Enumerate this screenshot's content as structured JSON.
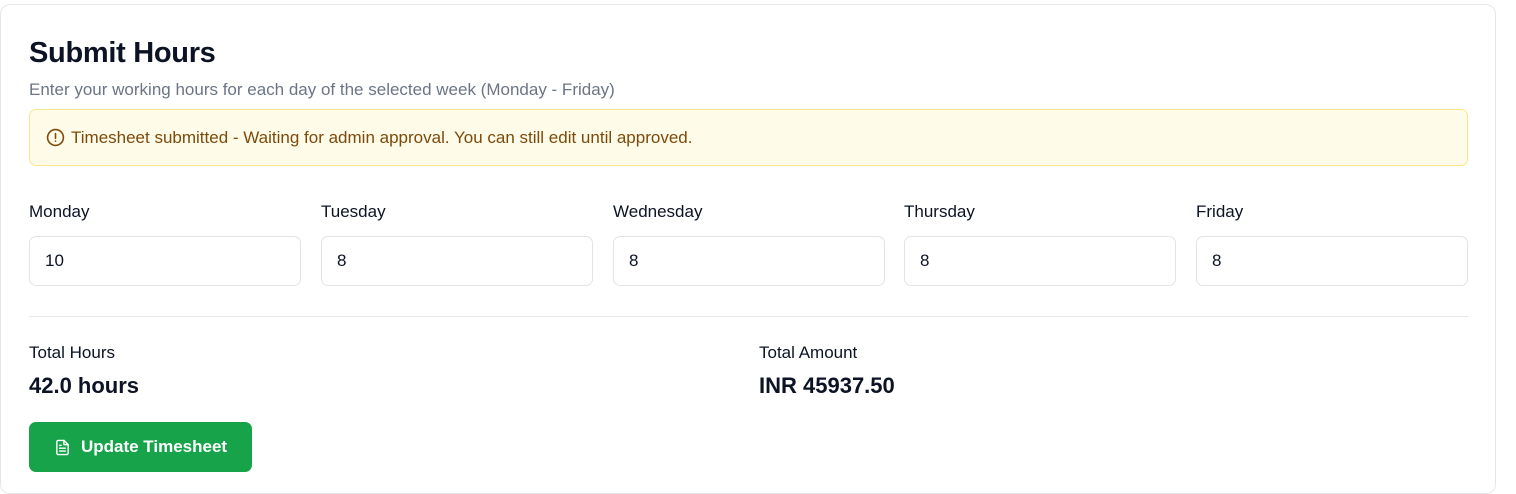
{
  "page": {
    "title": "Submit Hours",
    "subtitle": "Enter your working hours for each day of the selected week (Monday - Friday)"
  },
  "alert": {
    "icon": "alert-circle-icon",
    "message": "Timesheet submitted - Waiting for admin approval. You can still edit until approved.",
    "background": "#fefbe8",
    "border": "#fde68a",
    "text_color": "#7c4a0c"
  },
  "days": [
    {
      "label": "Monday",
      "value": "10"
    },
    {
      "label": "Tuesday",
      "value": "8"
    },
    {
      "label": "Wednesday",
      "value": "8"
    },
    {
      "label": "Thursday",
      "value": "8"
    },
    {
      "label": "Friday",
      "value": "8"
    }
  ],
  "totals": {
    "hours_label": "Total Hours",
    "hours_value": "42.0 hours",
    "amount_label": "Total Amount",
    "amount_value": "INR 45937.50"
  },
  "actions": {
    "update_label": "Update Timesheet",
    "update_icon": "file-text-icon",
    "accent": "#17a34a"
  }
}
